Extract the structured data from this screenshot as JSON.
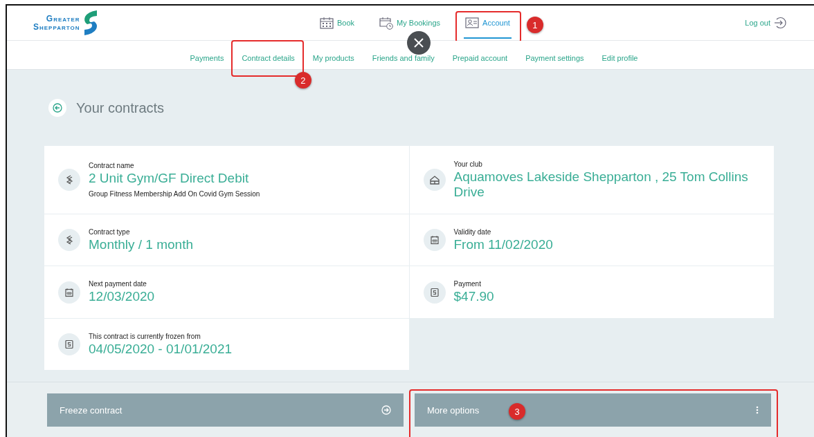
{
  "header": {
    "logo": {
      "line1": "Greater",
      "line2": "Shepparton"
    },
    "nav": [
      {
        "label": "Book",
        "selected": false
      },
      {
        "label": "My Bookings",
        "selected": false
      },
      {
        "label": "Account",
        "selected": true,
        "callout": "1"
      }
    ],
    "logout": "Log out"
  },
  "subnav": [
    {
      "label": "Payments"
    },
    {
      "label": "Contract details",
      "callout": "2"
    },
    {
      "label": "My products"
    },
    {
      "label": "Friends and family"
    },
    {
      "label": "Prepaid account"
    },
    {
      "label": "Payment settings"
    },
    {
      "label": "Edit profile"
    }
  ],
  "page_title": "Your contracts",
  "left_fields": [
    {
      "kind": "contract",
      "label": "Contract name",
      "value": "2 Unit Gym/GF Direct Debit",
      "note": "Group Fitness Membership Add On Covid Gym Session"
    },
    {
      "kind": "contract",
      "label": "Contract type",
      "value": "Monthly / 1 month"
    },
    {
      "kind": "date",
      "label": "Next payment date",
      "value": "12/03/2020"
    },
    {
      "kind": "money",
      "label": "This contract is currently frozen from",
      "value": "04/05/2020 - 01/01/2021"
    }
  ],
  "right_fields": [
    {
      "kind": "club",
      "label": "Your club",
      "value": "Aquamoves Lakeside Shepparton , 25 Tom Collins Drive"
    },
    {
      "kind": "date",
      "label": "Validity date",
      "value": "From 11/02/2020"
    },
    {
      "kind": "money",
      "label": "Payment",
      "value": "$47.90"
    }
  ],
  "actions": [
    {
      "label": "Freeze contract"
    },
    {
      "label": "More options",
      "callout": "3"
    }
  ]
}
